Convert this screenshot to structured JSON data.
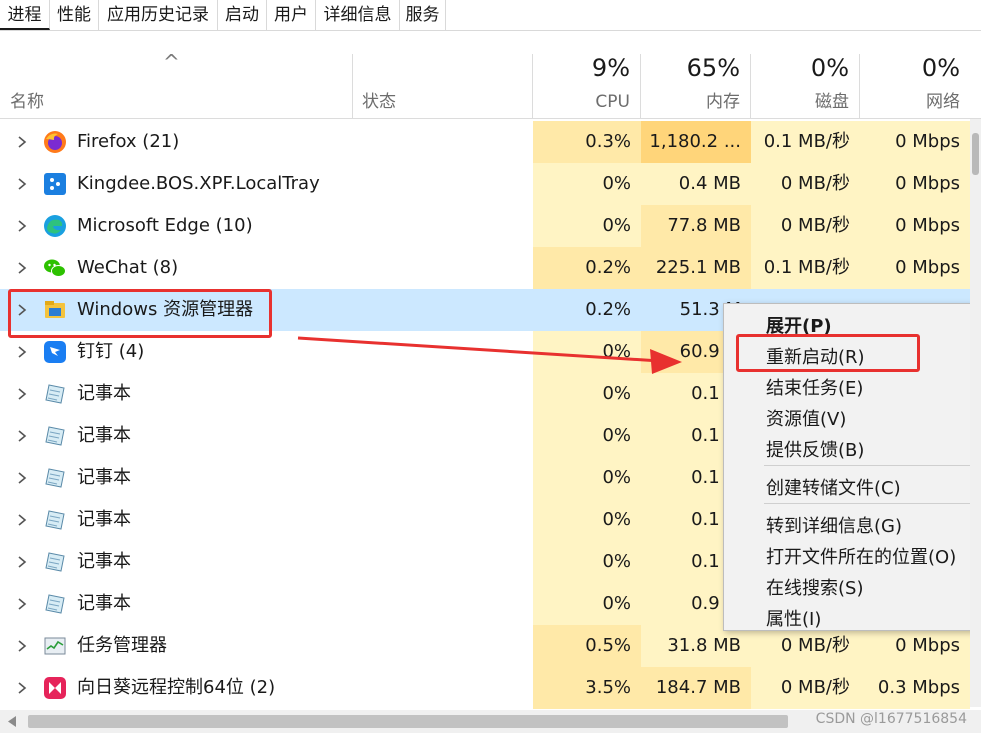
{
  "tabs": [
    "进程",
    "性能",
    "应用历史记录",
    "启动",
    "用户",
    "详细信息",
    "服务"
  ],
  "header": {
    "sort_glyph": "^",
    "name_label": "名称",
    "status_label": "状态",
    "cpu": {
      "pct": "9%",
      "label": "CPU"
    },
    "memory": {
      "pct": "65%",
      "label": "内存"
    },
    "disk": {
      "pct": "0%",
      "label": "磁盘"
    },
    "network": {
      "pct": "0%",
      "label": "网络"
    }
  },
  "rows": [
    {
      "name": "Firefox (21)",
      "icon": "firefox-icon",
      "cpu": "0.3%",
      "mem": "1,180.2 ...",
      "disk": "0.1 MB/秒",
      "net": "0 Mbps"
    },
    {
      "name": "Kingdee.BOS.XPF.LocalTray",
      "icon": "kingdee-icon",
      "cpu": "0%",
      "mem": "0.4 MB",
      "disk": "0 MB/秒",
      "net": "0 Mbps"
    },
    {
      "name": "Microsoft Edge (10)",
      "icon": "edge-icon",
      "cpu": "0%",
      "mem": "77.8 MB",
      "disk": "0 MB/秒",
      "net": "0 Mbps"
    },
    {
      "name": "WeChat (8)",
      "icon": "wechat-icon",
      "cpu": "0.2%",
      "mem": "225.1 MB",
      "disk": "0.1 MB/秒",
      "net": "0 Mbps"
    },
    {
      "name": "Windows 资源管理器",
      "icon": "folder-icon",
      "cpu": "0.2%",
      "mem": "51.3 M",
      "disk": "",
      "net": ""
    },
    {
      "name": "钉钉 (4)",
      "icon": "dingtalk-icon",
      "cpu": "0%",
      "mem": "60.9 M",
      "disk": "",
      "net": ""
    },
    {
      "name": "记事本",
      "icon": "notepad-icon",
      "cpu": "0%",
      "mem": "0.1 M",
      "disk": "",
      "net": ""
    },
    {
      "name": "记事本",
      "icon": "notepad-icon",
      "cpu": "0%",
      "mem": "0.1 M",
      "disk": "",
      "net": ""
    },
    {
      "name": "记事本",
      "icon": "notepad-icon",
      "cpu": "0%",
      "mem": "0.1 M",
      "disk": "",
      "net": ""
    },
    {
      "name": "记事本",
      "icon": "notepad-icon",
      "cpu": "0%",
      "mem": "0.1 M",
      "disk": "",
      "net": ""
    },
    {
      "name": "记事本",
      "icon": "notepad-icon",
      "cpu": "0%",
      "mem": "0.1 M",
      "disk": "",
      "net": ""
    },
    {
      "name": "记事本",
      "icon": "notepad-icon",
      "cpu": "0%",
      "mem": "0.9 M",
      "disk": "",
      "net": ""
    },
    {
      "name": "任务管理器",
      "icon": "task-manager-icon",
      "cpu": "0.5%",
      "mem": "31.8 MB",
      "disk": "0 MB/秒",
      "net": "0 Mbps"
    },
    {
      "name": "向日葵远程控制64位 (2)",
      "icon": "sunlogin-icon",
      "cpu": "3.5%",
      "mem": "184.7 MB",
      "disk": "0 MB/秒",
      "net": "0.3 Mbps"
    }
  ],
  "context_menu": {
    "items": [
      {
        "label": "展开(P)",
        "bold": true
      },
      {
        "label": "重新启动(R)"
      },
      {
        "label": "结束任务(E)"
      },
      {
        "label": "资源值(V)"
      },
      {
        "label": "提供反馈(B)"
      },
      {
        "label": "创建转储文件(C)"
      },
      {
        "label": "转到详细信息(G)"
      },
      {
        "label": "打开文件所在的位置(O)"
      },
      {
        "label": "在线搜索(S)"
      },
      {
        "label": "属性(I)"
      }
    ]
  },
  "watermark": "CSDN @l1677516854",
  "colors": {
    "highlight": "#e8312f",
    "selected": "#cce8ff",
    "heat_low": "#fff4c4",
    "heat_mid": "#ffe9a8",
    "heat_high": "#ffd57a"
  }
}
